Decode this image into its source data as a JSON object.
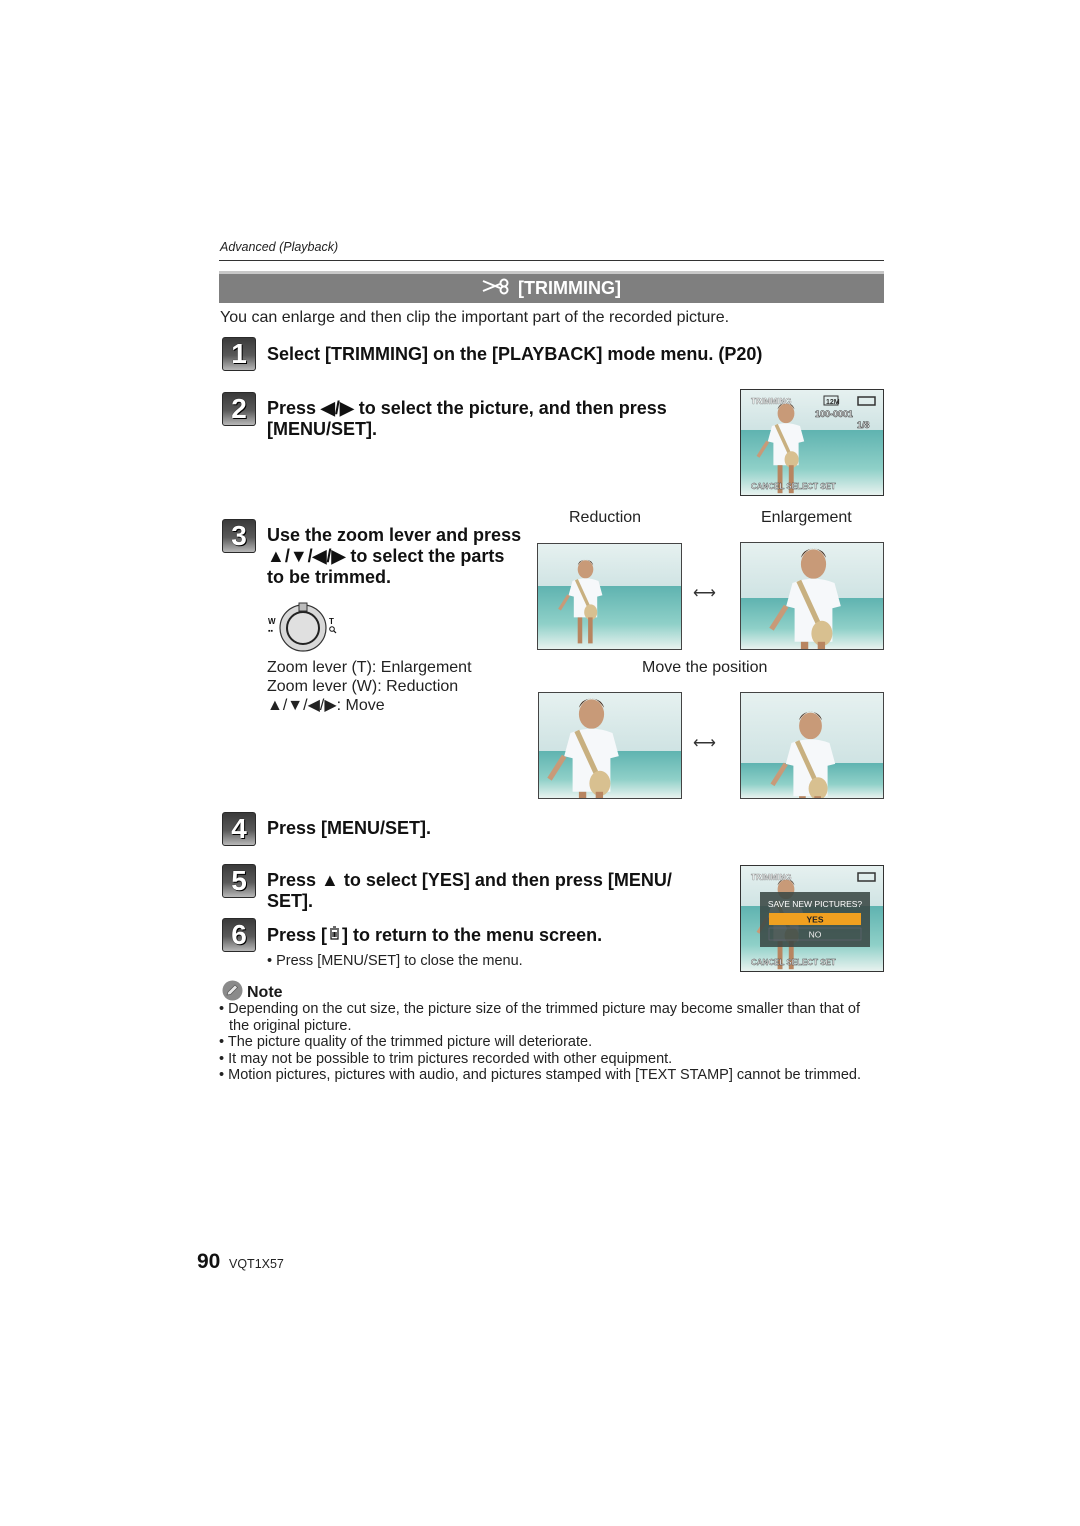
{
  "header": {
    "section_label": "Advanced (Playback)",
    "title_icon": "scissors-icon",
    "title": "[TRIMMING]",
    "intro": "You can enlarge and then clip the important part of the recorded picture."
  },
  "steps": [
    {
      "number": "1",
      "lines": [
        "Select [TRIMMING] on the [PLAYBACK] mode menu. (P20)"
      ]
    },
    {
      "number": "2",
      "lines": [
        "Press ◀/▶ to select the picture, and then press",
        "[MENU/SET]."
      ]
    },
    {
      "number": "3",
      "lines": [
        "Use the zoom lever and press",
        "▲/▼/◀/▶ to select the parts",
        "to be trimmed."
      ]
    },
    {
      "number": "4",
      "lines": [
        "Press [MENU/SET]."
      ]
    },
    {
      "number": "5",
      "lines": [
        "Press ▲ to select [YES] and then press [MENU/",
        "SET]."
      ]
    },
    {
      "number": "6",
      "lines": [
        "Press [",
        "] to return to the menu screen."
      ],
      "icon": "trash-icon",
      "sub_bullet": "• Press [MENU/SET] to close the menu."
    }
  ],
  "zoom_lever": {
    "w_label": "W",
    "t_label": "T",
    "descriptions": [
      "Zoom lever (T): Enlargement",
      "Zoom lever (W): Reduction",
      "▲/▼/◀/▶: Move"
    ]
  },
  "illustrations": {
    "reduction_label": "Reduction",
    "enlargement_label": "Enlargement",
    "move_label": "Move the position",
    "arrow": "⟷"
  },
  "lcd_select": {
    "title": "TRIMMING",
    "size": "12M",
    "file_no": "100-0001",
    "count": "1/8",
    "footer": "CANCEL SELECT SET"
  },
  "lcd_confirm": {
    "title": "TRIMMING",
    "question": "SAVE NEW PICTURES?",
    "yes": "YES",
    "no": "NO",
    "footer": "CANCEL SELECT SET",
    "highlight_color": "#f0a020"
  },
  "note": {
    "title": "Note",
    "items": [
      "Depending on the cut size, the picture size of the trimmed picture may become smaller than that of the original picture.",
      "The picture quality of the trimmed picture will deteriorate.",
      "It may not be possible to trim pictures recorded with other equipment.",
      "Motion pictures, pictures with audio, and pictures stamped with [TEXT STAMP] cannot be trimmed."
    ]
  },
  "footer": {
    "page_number": "90",
    "model_code": "VQT1X57"
  }
}
